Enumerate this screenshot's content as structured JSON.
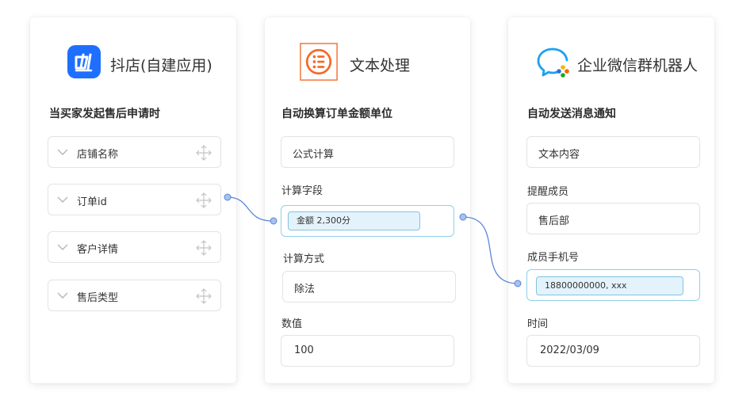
{
  "card1": {
    "app_name": "抖店(自建应用)",
    "app_icon": "douyin-store-icon",
    "trigger_title": "当买家发起售后申请时",
    "fields": [
      {
        "label": "店铺名称"
      },
      {
        "label": "订单id"
      },
      {
        "label": "客户详情"
      },
      {
        "label": "售后类型"
      }
    ]
  },
  "card2": {
    "app_name": "文本处理",
    "app_icon": "text-processing-icon",
    "action_title": "自动换算订单金额单位",
    "operation_value": "公式计算",
    "field_label": "计算字段",
    "field_chip": "金额 2,300分",
    "method_label": "计算方式",
    "method_value": "除法",
    "number_label": "数值",
    "number_value": "100"
  },
  "card3": {
    "app_name": "企业微信群机器人",
    "app_icon": "wecom-bot-icon",
    "action_title": "自动发送消息通知",
    "content_value": "文本内容",
    "remind_label": "提醒成员",
    "remind_value": "售后部",
    "phone_label": "成员手机号",
    "phone_chip": "18800000000, xxx",
    "time_label": "时间",
    "time_value": "2022/03/09"
  },
  "colors": {
    "accent_blue": "#1f6fff",
    "accent_orange": "#f26b2c",
    "connector": "#5b86d6",
    "chip_bg": "#e4f3fb",
    "chip_border": "#7ec4e2"
  }
}
